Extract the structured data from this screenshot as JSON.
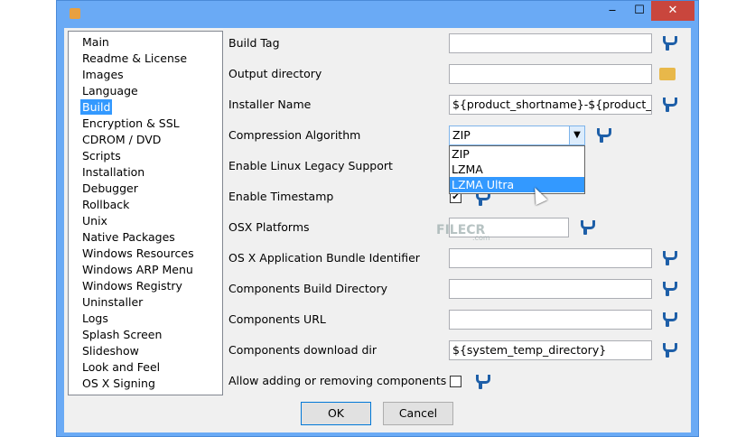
{
  "window": {
    "minimize": "‒",
    "maximize": "☐",
    "close": "✕"
  },
  "sidebar": {
    "items": [
      "Main",
      "Readme & License",
      "Images",
      "Language",
      "Build",
      "Encryption & SSL",
      "CDROM / DVD",
      "Scripts",
      "Installation",
      "Debugger",
      "Rollback",
      "Unix",
      "Native Packages",
      "Windows Resources",
      "Windows ARP Menu",
      "Windows Registry",
      "Uninstaller",
      "Logs",
      "Splash Screen",
      "Slideshow",
      "Look and Feel",
      "OS X Signing"
    ],
    "selected": "Build"
  },
  "form": {
    "build_tag": {
      "label": "Build Tag",
      "value": ""
    },
    "output_directory": {
      "label": "Output directory",
      "value": ""
    },
    "installer_name": {
      "label": "Installer Name",
      "value": "${product_shortname}-${product_version}"
    },
    "compression": {
      "label": "Compression Algorithm",
      "value": "ZIP",
      "options": [
        "ZIP",
        "LZMA",
        "LZMA Ultra"
      ],
      "highlighted": "LZMA Ultra"
    },
    "linux_legacy": {
      "label": "Enable Linux Legacy Support"
    },
    "timestamp": {
      "label": "Enable Timestamp",
      "check": "✔"
    },
    "osx_platforms": {
      "label": "OSX Platforms",
      "value": ""
    },
    "osx_bundle_id": {
      "label": "OS X Application Bundle Identifier",
      "value": ""
    },
    "components_build_dir": {
      "label": "Components Build Directory",
      "value": ""
    },
    "components_url": {
      "label": "Components URL",
      "value": ""
    },
    "components_download_dir": {
      "label": "Components download dir",
      "value": "${system_temp_directory}"
    },
    "allow_components": {
      "label": "Allow adding or removing components"
    }
  },
  "buttons": {
    "ok": "OK",
    "cancel": "Cancel"
  },
  "watermark": {
    "text": "FILECR",
    "sub": ".com"
  }
}
